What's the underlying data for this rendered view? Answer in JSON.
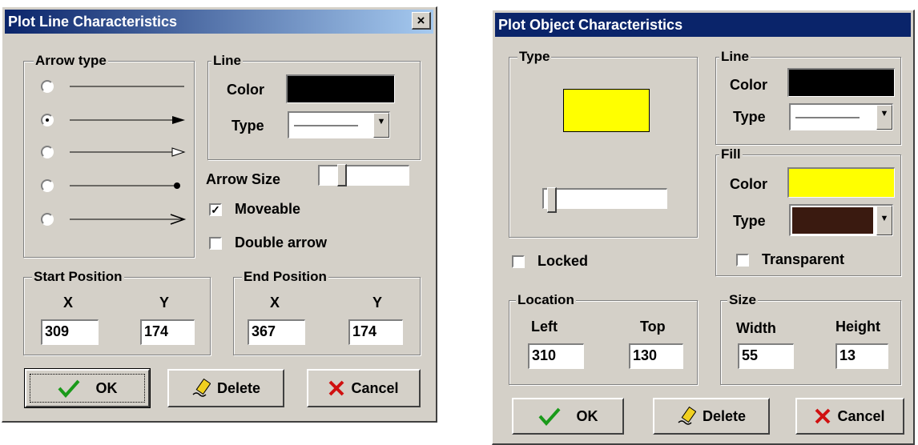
{
  "dialog1": {
    "title": "Plot Line Characteristics",
    "close_glyph": "×",
    "arrow_type_label": "Arrow type",
    "arrow_types": [
      {
        "name": "plain",
        "selected": false
      },
      {
        "name": "filled-arrow",
        "selected": true
      },
      {
        "name": "open-arrow",
        "selected": false
      },
      {
        "name": "dot",
        "selected": false
      },
      {
        "name": "line-arrow",
        "selected": false
      }
    ],
    "line_group_label": "Line",
    "color_label": "Color",
    "line_color": "#000000",
    "type_label": "Type",
    "arrow_size_label": "Arrow Size",
    "moveable_label": "Moveable",
    "moveable_checked": true,
    "double_arrow_label": "Double arrow",
    "double_arrow_checked": false,
    "start_position_label": "Start Position",
    "end_position_label": "End Position",
    "x_label": "X",
    "y_label": "Y",
    "start_x": "309",
    "start_y": "174",
    "end_x": "367",
    "end_y": "174",
    "ok_label": "OK",
    "delete_label": "Delete",
    "cancel_label": "Cancel"
  },
  "dialog2": {
    "title": "Plot Object Characteristics",
    "type_group_label": "Type",
    "object_color": "#ffff00",
    "locked_label": "Locked",
    "locked_checked": false,
    "line_group_label": "Line",
    "line_color_label": "Color",
    "line_color": "#000000",
    "line_type_label": "Type",
    "fill_group_label": "Fill",
    "fill_color_label": "Color",
    "fill_color": "#ffff00",
    "fill_type_label": "Type",
    "fill_type_color": "#3a1a10",
    "transparent_label": "Transparent",
    "transparent_checked": false,
    "location_label": "Location",
    "left_label": "Left",
    "top_label": "Top",
    "left_value": "310",
    "top_value": "130",
    "size_label": "Size",
    "width_label": "Width",
    "height_label": "Height",
    "width_value": "55",
    "height_value": "13",
    "ok_label": "OK",
    "delete_label": "Delete",
    "cancel_label": "Cancel"
  }
}
